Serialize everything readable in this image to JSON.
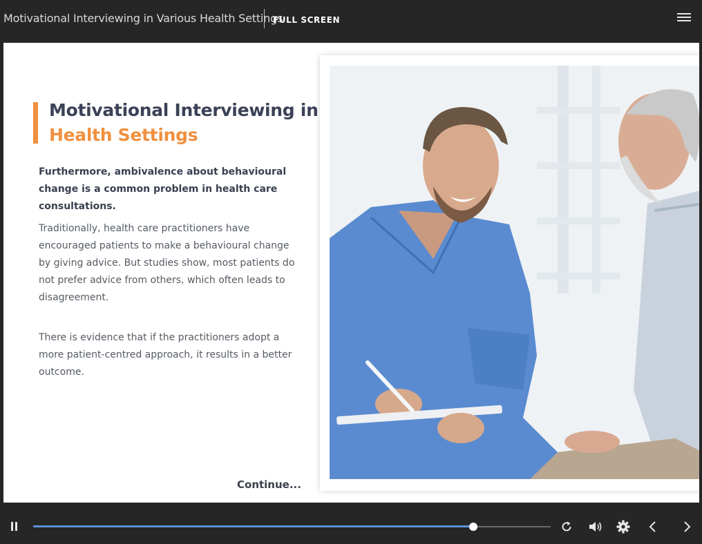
{
  "header": {
    "course_title": "Motivational Interviewing in Various Health Settings",
    "fullscreen_label": "FULL SCREEN"
  },
  "slide": {
    "heading_line1": "Motivational Interviewing in",
    "heading_line2": "Health Settings",
    "para1": "Furthermore, ambivalence about behavioural change is a common problem in health care consultations.",
    "para2": "Traditionally, health care practitioners have encouraged patients to make a behavioural change by giving advice. But studies show, most patients do not prefer advice from others, which often leads to disagreement.",
    "para3": "There is evidence that if the practitioners adopt a more patient-centred approach, it results in a better outcome.",
    "continue_label": "Continue..."
  },
  "player": {
    "progress_percent": 85,
    "colors": {
      "accent": "#f0903f",
      "progress": "#5b8fd6",
      "bar": "#262626"
    },
    "icons": [
      "pause-icon",
      "replay-icon",
      "volume-icon",
      "settings-icon",
      "chevron-left-icon",
      "chevron-right-icon",
      "hamburger-menu-icon"
    ]
  }
}
